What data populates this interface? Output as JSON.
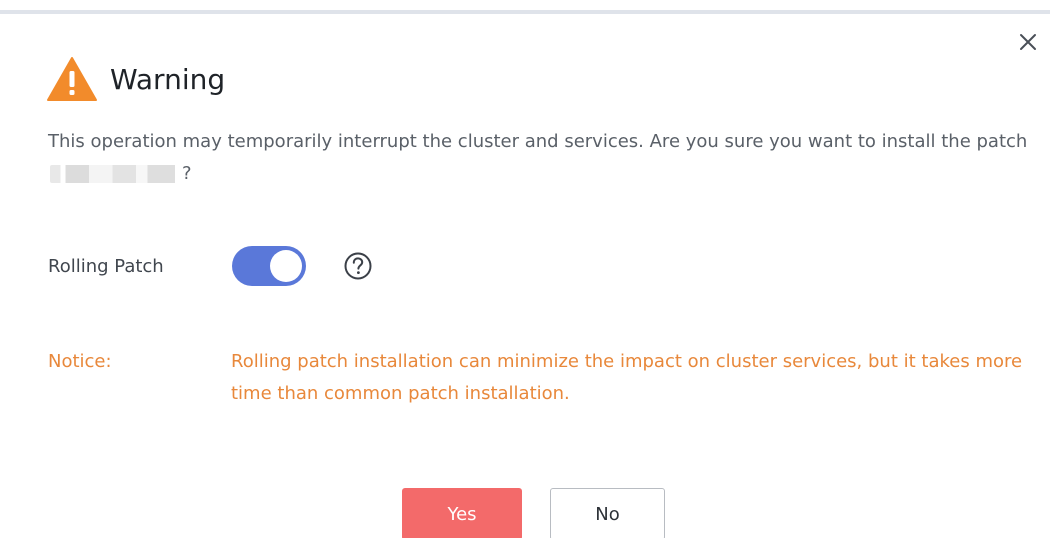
{
  "dialog": {
    "title": "Warning",
    "message_before": "This operation may temporarily interrupt the cluster and services. Are you sure you want to install the patch ",
    "message_after": "?",
    "rolling_patch_label": "Rolling Patch",
    "rolling_patch_enabled": true,
    "notice_label": "Notice:",
    "notice_text": "Rolling patch installation can minimize the impact on cluster services, but it takes more time than common patch installation.",
    "yes_label": "Yes",
    "no_label": "No"
  },
  "icons": {
    "close": "close-icon",
    "warning": "warning-icon",
    "help": "help-icon"
  },
  "colors": {
    "accent_toggle": "#5a78d9",
    "warning_icon": "#f28b2b",
    "notice": "#e8883b",
    "yes_button": "#f36a6a"
  }
}
